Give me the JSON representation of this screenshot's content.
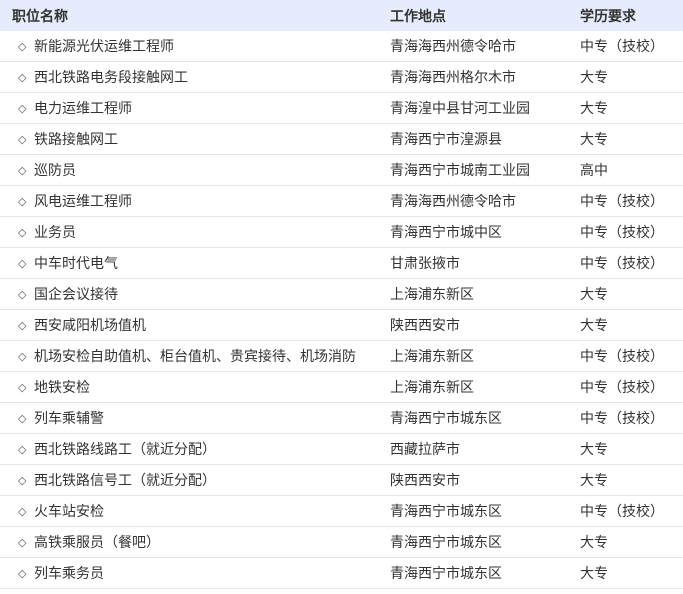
{
  "table": {
    "headers": {
      "position": "职位名称",
      "location": "工作地点",
      "education": "学历要求"
    },
    "bullet_icon": "◇",
    "rows": [
      {
        "position": "新能源光伏运维工程师",
        "location": "青海海西州德令哈市",
        "education": "中专（技校）"
      },
      {
        "position": "西北铁路电务段接触网工",
        "location": "青海海西州格尔木市",
        "education": "大专"
      },
      {
        "position": "电力运维工程师",
        "location": "青海湟中县甘河工业园",
        "education": "大专"
      },
      {
        "position": "铁路接触网工",
        "location": "青海西宁市湟源县",
        "education": "大专"
      },
      {
        "position": "巡防员",
        "location": "青海西宁市城南工业园",
        "education": "高中"
      },
      {
        "position": "风电运维工程师",
        "location": "青海海西州德令哈市",
        "education": "中专（技校）"
      },
      {
        "position": "业务员",
        "location": "青海西宁市城中区",
        "education": "中专（技校）"
      },
      {
        "position": "中车时代电气",
        "location": "甘肃张掖市",
        "education": "中专（技校）"
      },
      {
        "position": "国企会议接待",
        "location": "上海浦东新区",
        "education": "大专"
      },
      {
        "position": "西安咸阳机场值机",
        "location": "陕西西安市",
        "education": "大专"
      },
      {
        "position": "机场安检自助值机、柜台值机、贵宾接待、机场消防",
        "location": "上海浦东新区",
        "education": "中专（技校）"
      },
      {
        "position": "地铁安检",
        "location": "上海浦东新区",
        "education": "中专（技校）"
      },
      {
        "position": "列车乘辅警",
        "location": "青海西宁市城东区",
        "education": "中专（技校）"
      },
      {
        "position": "西北铁路线路工（就近分配）",
        "location": "西藏拉萨市",
        "education": "大专"
      },
      {
        "position": "西北铁路信号工（就近分配）",
        "location": "陕西西安市",
        "education": "大专"
      },
      {
        "position": "火车站安检",
        "location": "青海西宁市城东区",
        "education": "中专（技校）"
      },
      {
        "position": "高铁乘服员（餐吧）",
        "location": "青海西宁市城东区",
        "education": "大专"
      },
      {
        "position": "列车乘务员",
        "location": "青海西宁市城东区",
        "education": "大专"
      }
    ]
  }
}
